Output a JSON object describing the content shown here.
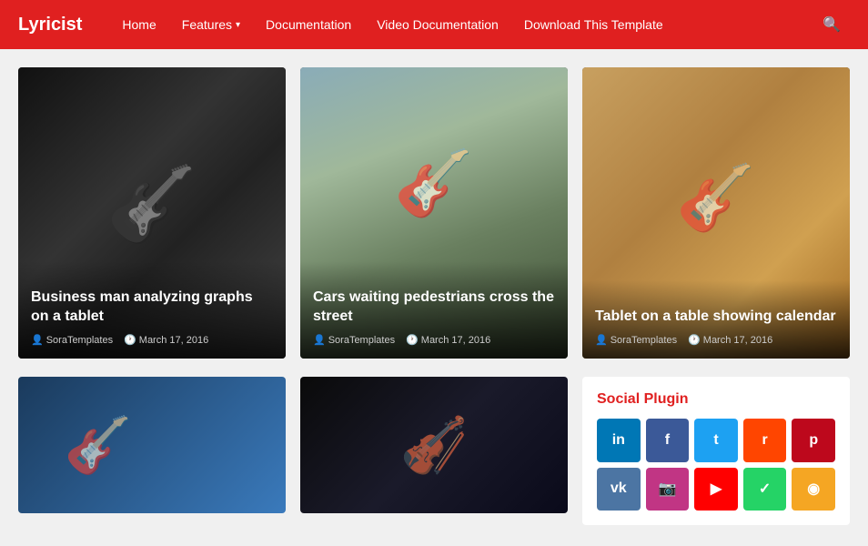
{
  "nav": {
    "brand": "Lyricist",
    "links": [
      {
        "label": "Home",
        "has_arrow": false
      },
      {
        "label": "Features",
        "has_arrow": true
      },
      {
        "label": "Documentation",
        "has_arrow": false
      },
      {
        "label": "Video Documentation",
        "has_arrow": false
      },
      {
        "label": "Download This Template",
        "has_arrow": false
      }
    ],
    "search_icon": "🔍"
  },
  "top_cards": [
    {
      "title": "Business man analyzing graphs on a tablet",
      "author": "SoraTemplates",
      "date": "March 17, 2016",
      "img_class": "card-img-1"
    },
    {
      "title": "Cars waiting pedestrians cross the street",
      "author": "SoraTemplates",
      "date": "March 17, 2016",
      "img_class": "card-img-2"
    },
    {
      "title": "Tablet on a table showing calendar",
      "author": "SoraTemplates",
      "date": "March 17, 2016",
      "img_class": "card-img-3"
    }
  ],
  "social_plugin": {
    "title": "Social Plugin",
    "buttons": [
      {
        "label": "in",
        "color": "#0077b5",
        "name": "linkedin"
      },
      {
        "label": "f",
        "color": "#3b5998",
        "name": "facebook"
      },
      {
        "label": "t",
        "color": "#1da1f2",
        "name": "twitter"
      },
      {
        "label": "r",
        "color": "#ff4500",
        "name": "reddit"
      },
      {
        "label": "p",
        "color": "#bd081c",
        "name": "pinterest"
      },
      {
        "label": "vk",
        "color": "#4c75a3",
        "name": "vk"
      },
      {
        "label": "📷",
        "color": "#c13584",
        "name": "instagram"
      },
      {
        "label": "▶",
        "color": "#ff0000",
        "name": "youtube"
      },
      {
        "label": "✓",
        "color": "#25d366",
        "name": "whatsapp"
      },
      {
        "label": "◉",
        "color": "#f5a623",
        "name": "rss"
      }
    ]
  },
  "person_icon": "👤",
  "clock_icon": "🕐"
}
